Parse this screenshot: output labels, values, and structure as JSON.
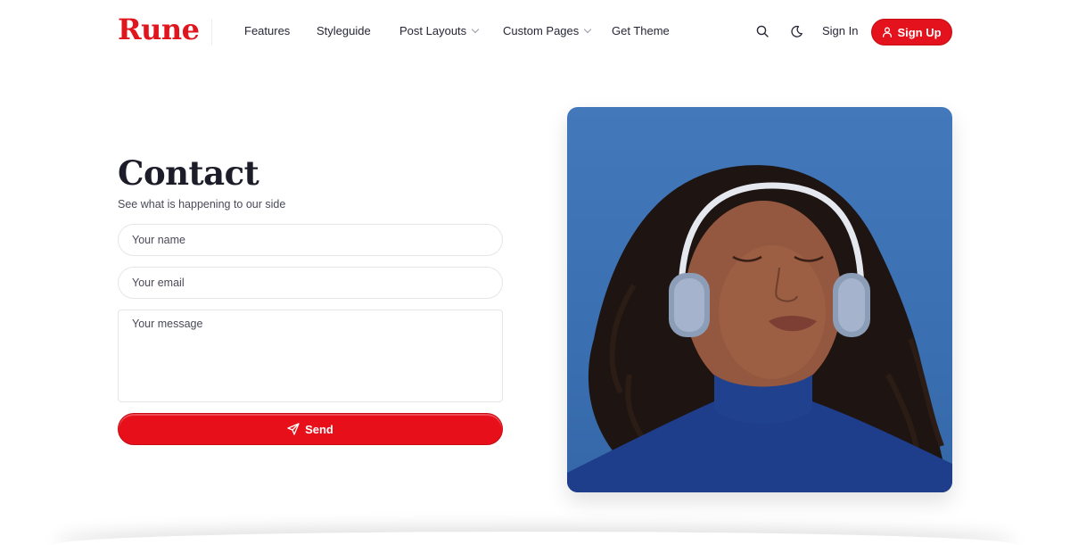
{
  "header": {
    "logo": "Rune",
    "nav": [
      {
        "label": "Features"
      },
      {
        "label": "Styleguide"
      },
      {
        "label": "Post Layouts"
      },
      {
        "label": "Custom Pages"
      },
      {
        "label": "Get Theme"
      }
    ],
    "signin_label": "Sign In",
    "signup_label": "Sign Up"
  },
  "contact": {
    "title": "Contact",
    "subtitle": "See what is happening to our side",
    "name_placeholder": "Your name",
    "email_placeholder": "Your email",
    "message_placeholder": "Your message",
    "send_label": "Send"
  },
  "colors": {
    "accent": "#e3121c",
    "photo_bg": "#4379bb"
  },
  "icons": [
    "search-icon",
    "moon-icon",
    "user-icon",
    "send-icon",
    "chevron-down-icon"
  ]
}
